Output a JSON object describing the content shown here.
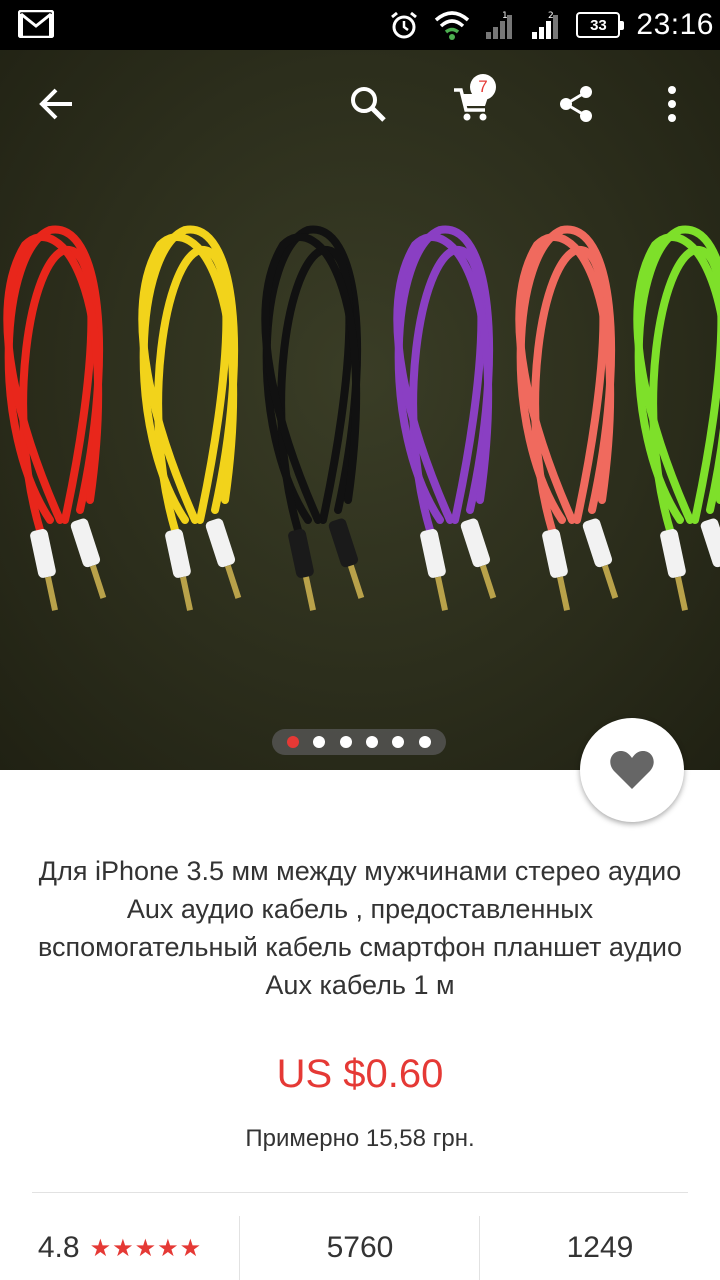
{
  "status_bar": {
    "time": "23:16",
    "battery": "33",
    "icons": [
      "gmail-icon",
      "alarm-icon",
      "wifi-icon",
      "signal-1-icon",
      "signal-2-icon",
      "battery-icon"
    ]
  },
  "toolbar": {
    "icons": [
      "back-arrow-icon",
      "search-icon",
      "cart-icon",
      "share-icon",
      "more-vert-icon"
    ],
    "cart_count": "7"
  },
  "gallery": {
    "image_count": 6,
    "active_index": 0,
    "cable_colors": [
      "#e8261b",
      "#f2d31b",
      "#111111",
      "#8a3fc3",
      "#f06a5e",
      "#7ee02a"
    ]
  },
  "product": {
    "title": "Для iPhone 3.5 мм между мужчинами стерео аудио Aux аудио кабель , предоставленных вспомогательный кабель смартфон планшет аудио Aux кабель 1 м",
    "price": "US $0.60",
    "approx_price": "Примерно 15,58 грн.",
    "rating": "4.8",
    "stars": "★★★★★",
    "orders": "5760",
    "feedback": "1249"
  },
  "colors": {
    "accent": "#e53935",
    "text": "#333333"
  }
}
